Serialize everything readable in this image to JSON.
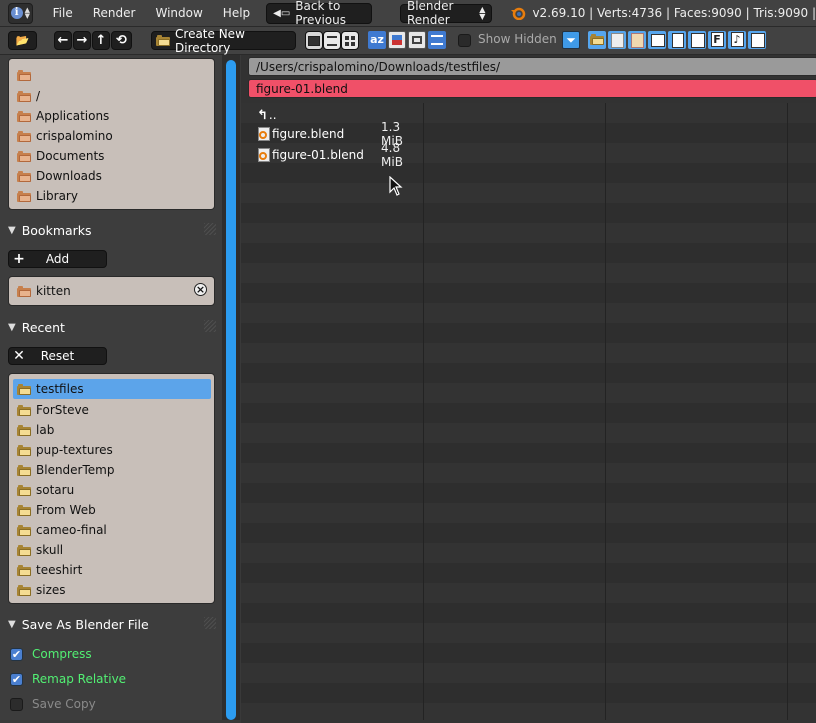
{
  "topbar": {
    "menus": [
      "File",
      "Render",
      "Window",
      "Help"
    ],
    "back_label": "Back to Previous",
    "renderer": "Blender Render",
    "stats": "v2.69.10 | Verts:4736 | Faces:9090 | Tris:9090 |"
  },
  "toolbar": {
    "create_dir_label": "Create New Directory",
    "show_hidden_label": "Show Hidden",
    "sort_label": "az"
  },
  "system": {
    "items": [
      "",
      "/",
      "Applications",
      "crispalomino",
      "Documents",
      "Downloads",
      "Library"
    ]
  },
  "bookmarks": {
    "title": "Bookmarks",
    "add_label": "Add",
    "items": [
      "kitten"
    ]
  },
  "recent": {
    "title": "Recent",
    "reset_label": "Reset",
    "selected": "testfiles",
    "items": [
      "testfiles",
      "ForSteve",
      "lab",
      "pup-textures",
      "BlenderTemp",
      "sotaru",
      "From Web",
      "cameo-final",
      "skull",
      "teeshirt",
      "sizes"
    ]
  },
  "save_options": {
    "title": "Save As Blender File",
    "options": [
      {
        "label": "Compress",
        "checked": true
      },
      {
        "label": "Remap Relative",
        "checked": true
      },
      {
        "label": "Save Copy",
        "checked": false
      }
    ]
  },
  "browser": {
    "path": "/Users/crispalomino/Downloads/testfiles/",
    "filename": "figure-01.blend",
    "parent_label": "..",
    "files": [
      {
        "name": "figure.blend",
        "size": "1.3 MiB"
      },
      {
        "name": "figure-01.blend",
        "size": "4.8 MiB"
      }
    ]
  },
  "colors": {
    "accent_blue": "#5ca4ea",
    "filename_red": "#f05068",
    "checked_label_green": "#52f073"
  }
}
